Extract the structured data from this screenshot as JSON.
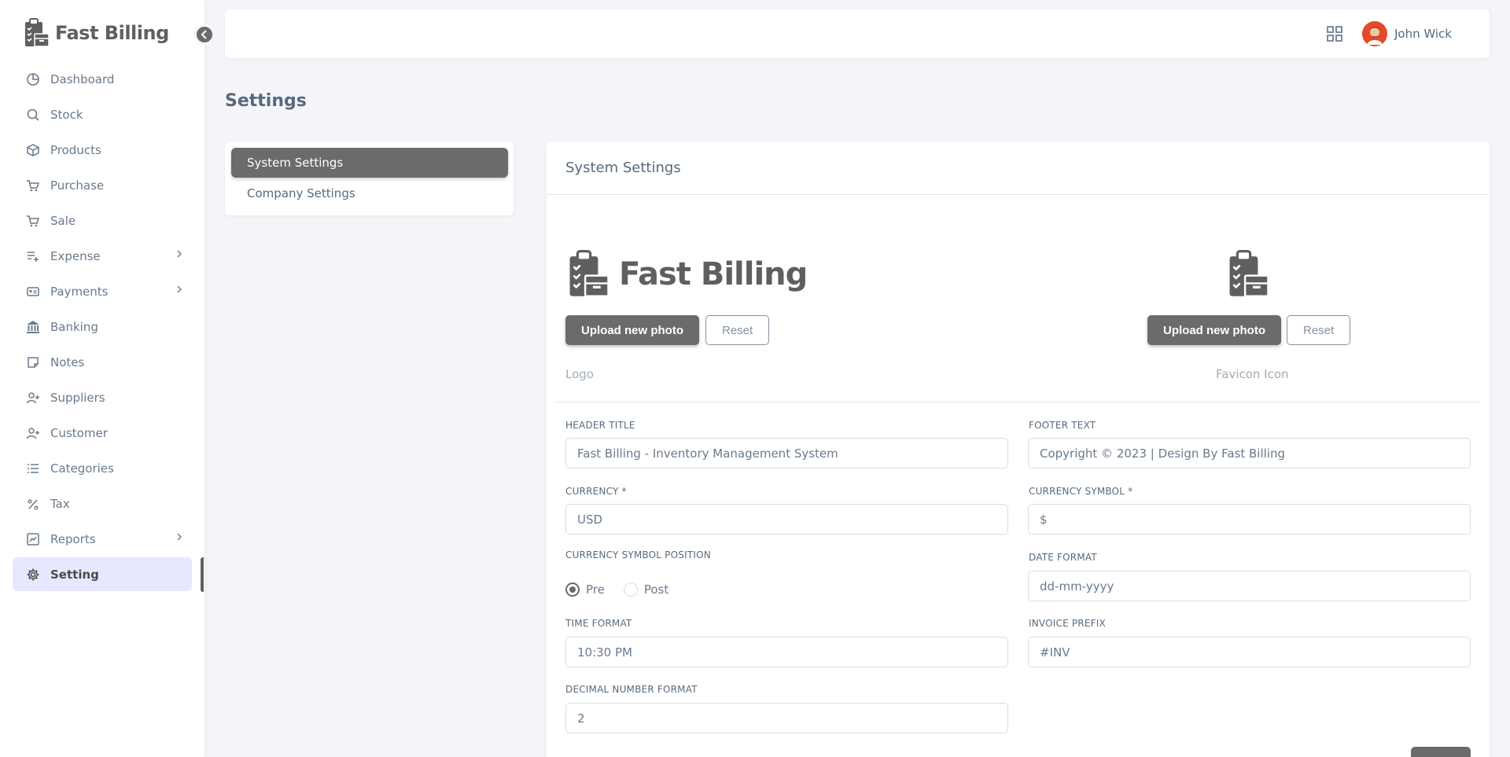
{
  "brand": {
    "name": "Fast Billing"
  },
  "sidebar": {
    "items": [
      {
        "label": "Dashboard",
        "icon": "pie-chart-icon"
      },
      {
        "label": "Stock",
        "icon": "search-icon"
      },
      {
        "label": "Products",
        "icon": "box-icon"
      },
      {
        "label": "Purchase",
        "icon": "cart-icon"
      },
      {
        "label": "Sale",
        "icon": "cart-icon"
      },
      {
        "label": "Expense",
        "icon": "list-plus-icon",
        "has_submenu": true
      },
      {
        "label": "Payments",
        "icon": "id-card-icon",
        "has_submenu": true
      },
      {
        "label": "Banking",
        "icon": "bank-icon"
      },
      {
        "label": "Notes",
        "icon": "note-icon"
      },
      {
        "label": "Suppliers",
        "icon": "user-plus-icon"
      },
      {
        "label": "Customer",
        "icon": "user-plus-icon"
      },
      {
        "label": "Categories",
        "icon": "list-icon"
      },
      {
        "label": "Tax",
        "icon": "percent-icon"
      },
      {
        "label": "Reports",
        "icon": "chart-icon",
        "has_submenu": true
      },
      {
        "label": "Setting",
        "icon": "gear-icon",
        "active": true
      }
    ]
  },
  "header": {
    "user_name": "John Wick"
  },
  "page": {
    "title": "Settings"
  },
  "settings_nav": {
    "items": [
      {
        "label": "System Settings",
        "active": true
      },
      {
        "label": "Company Settings",
        "active": false
      }
    ]
  },
  "card": {
    "title": "System Settings",
    "logo_upload_label": "Upload new photo",
    "logo_reset_label": "Reset",
    "logo_caption": "Logo",
    "favicon_upload_label": "Upload new photo",
    "favicon_reset_label": "Reset",
    "favicon_caption": "Favicon Icon"
  },
  "form": {
    "header_title": {
      "label": "HEADER TITLE",
      "value": "Fast Billing - Inventory Management System"
    },
    "footer_text": {
      "label": "FOOTER TEXT",
      "value": "Copyright © 2023 | Design By Fast Billing"
    },
    "currency": {
      "label": "CURRENCY *",
      "value": "USD"
    },
    "currency_symbol": {
      "label": "CURRENCY SYMBOL *",
      "value": "$"
    },
    "currency_symbol_position": {
      "label": "CURRENCY SYMBOL POSITION",
      "options": [
        "Pre",
        "Post"
      ],
      "selected": "Pre"
    },
    "date_format": {
      "label": "DATE FORMAT",
      "value": "dd-mm-yyyy"
    },
    "time_format": {
      "label": "TIME FORMAT",
      "value": "10:30 PM"
    },
    "invoice_prefix": {
      "label": "INVOICE PREFIX",
      "value": "#INV"
    },
    "decimal_number_format": {
      "label": "DECIMAL NUMBER FORMAT",
      "value": "2"
    }
  },
  "colors": {
    "accent": "#6b6b6b",
    "active_bg": "#e7e7ff",
    "page_bg": "#f5f5f9"
  }
}
